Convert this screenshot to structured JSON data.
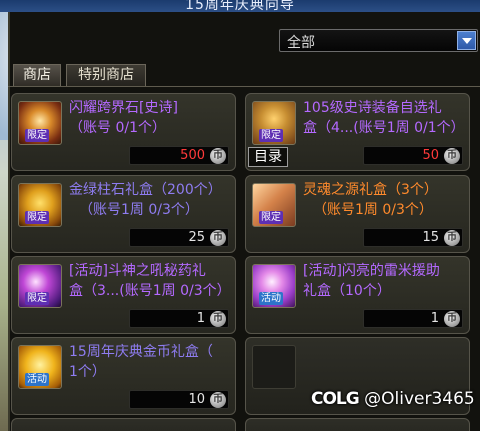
{
  "window": {
    "title": "15周年庆典向导"
  },
  "filter": {
    "selected": "全部"
  },
  "tabs": [
    {
      "label": "商店",
      "active": true
    },
    {
      "label": "特别商店",
      "active": false
    }
  ],
  "items": [
    {
      "name": "闪耀跨界石[史诗](账号 0/1个)",
      "badge": "限定",
      "price": "500",
      "price_color": "#ff3a3a",
      "rarity_color": "#b469ff",
      "icon": "crossover-stone-icon"
    },
    {
      "name": "105级史诗装备自选礼盒（4...(账号1周 0/1个)",
      "badge": "限定",
      "price": "50",
      "price_color": "#ff3a3a",
      "rarity_color": "#b469ff",
      "icon": "treasure-chest-icon",
      "overlay": "目录"
    },
    {
      "name": "金绿柱石礼盒（200个）(账号1周 0/3个)",
      "badge": "限定",
      "price": "25",
      "price_color": "#e6e6e6",
      "rarity_color": "#8e7cf0",
      "icon": "gold-gem-box-icon"
    },
    {
      "name": "灵魂之源礼盒（3个）(账号1周 0/3个)",
      "badge": "限定",
      "price": "15",
      "price_color": "#e6e6e6",
      "rarity_color": "#ff8a2c",
      "icon": "soul-source-box-icon"
    },
    {
      "name": "[活动]斗神之吼秘药礼盒（3...(账号1周 0/3个)",
      "badge": "限定",
      "price": "1",
      "price_color": "#e6e6e6",
      "rarity_color": "#b469ff",
      "icon": "potion-box-icon"
    },
    {
      "name": "[活动]闪亮的雷米援助礼盒（10个）",
      "badge": "活动",
      "price": "1",
      "price_color": "#e6e6e6",
      "rarity_color": "#b469ff",
      "icon": "remy-aid-box-icon"
    },
    {
      "name": "15周年庆典金币礼盒（1个）",
      "badge": "活动",
      "price": "10",
      "price_color": "#e6e6e6",
      "rarity_color": "#8e7cf0",
      "icon": "anniversary-coin-icon"
    }
  ],
  "item_lines": [
    [
      "闪耀跨界石[史诗]",
      "（账号 0/1个）"
    ],
    [
      "105级史诗装备自选礼",
      "盒（4...(账号1周 0/1个）"
    ],
    [
      "金绿柱石礼盒（200个）",
      "（账号1周 0/3个）"
    ],
    [
      "灵魂之源礼盒（3个）",
      "（账号1周 0/3个）"
    ],
    [
      "[活动]斗神之吼秘药礼",
      "盒（3...(账号1周 0/3个）"
    ],
    [
      "[活动]闪亮的雷米援助",
      "礼盒（10个）"
    ],
    [
      "15周年庆典金币礼盒（",
      "1个）"
    ]
  ],
  "coin_glyph": "币",
  "watermark": {
    "brand": "COLG",
    "user": "@Oliver3465"
  }
}
